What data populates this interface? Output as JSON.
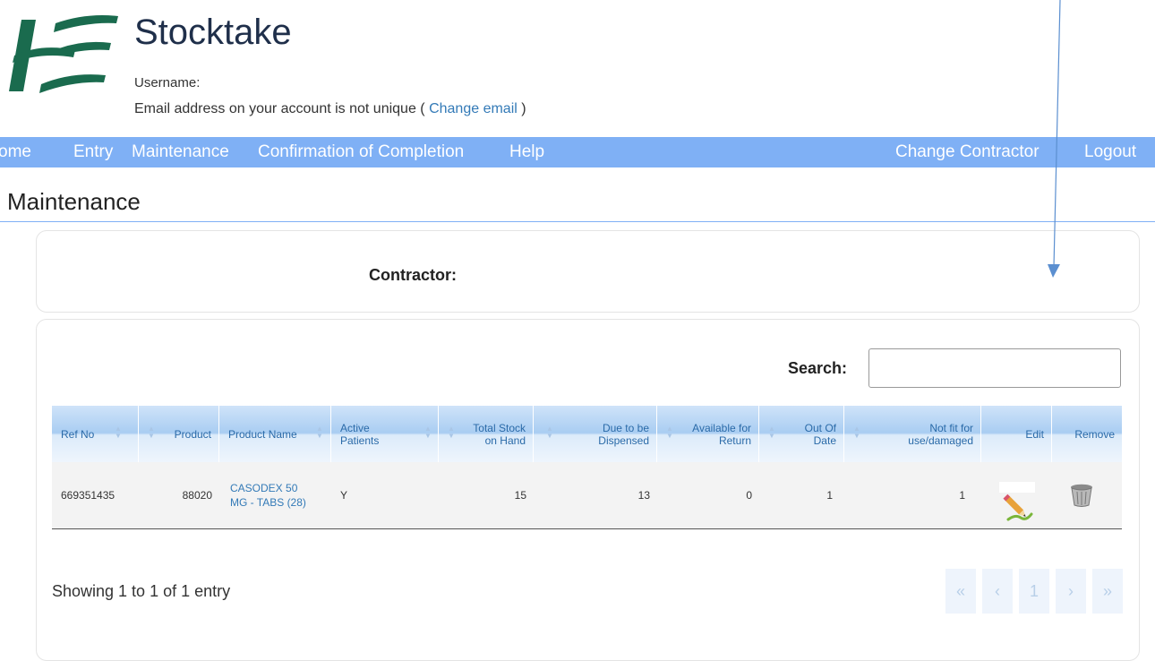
{
  "header": {
    "title": "Stocktake",
    "username_label": "Username:",
    "email_notice_prefix": "Email address on your account is not unique ( ",
    "email_link": "Change email",
    "email_notice_suffix": " )"
  },
  "nav": {
    "home": "ome",
    "entry": "Entry",
    "maintenance": "Maintenance",
    "confirmation": "Confirmation of Completion",
    "help": "Help",
    "change_contractor": "Change Contractor",
    "logout": "Logout"
  },
  "page_title": "Maintenance",
  "contractor_label": "Contractor:",
  "search": {
    "label": "Search:",
    "value": "",
    "placeholder": ""
  },
  "table": {
    "headers": {
      "ref_no": "Ref No",
      "product": "Product",
      "product_name": "Product Name",
      "active_patients_1": "Active",
      "active_patients_2": "Patients",
      "total_stock_1": "Total Stock",
      "total_stock_2": "on Hand",
      "due_1": "Due to be",
      "due_2": "Dispensed",
      "avail_1": "Available for",
      "avail_2": "Return",
      "ood_1": "Out Of",
      "ood_2": "Date",
      "nfit_1": "Not fit for",
      "nfit_2": "use/damaged",
      "edit": "Edit",
      "remove": "Remove"
    },
    "rows": [
      {
        "ref_no": "669351435",
        "product": "88020",
        "product_name_1": "CASODEX 50",
        "product_name_2": "MG - TABS (28)",
        "active_patients": "Y",
        "total_stock": "15",
        "due": "13",
        "available": "0",
        "out_of_date": "1",
        "not_fit": "1"
      }
    ]
  },
  "footer": {
    "showing": "Showing 1 to 1 of 1 entry",
    "pager": {
      "first": "«",
      "prev": "‹",
      "page": "1",
      "next": "›",
      "last": "»"
    }
  },
  "icons": {
    "logo": "hse-logo-icon",
    "edit": "pencil-icon",
    "remove": "trash-bin-icon"
  },
  "colors": {
    "nav_bg": "#7fb0f5",
    "link": "#337ab7",
    "header_text": "#2a6aa8"
  }
}
